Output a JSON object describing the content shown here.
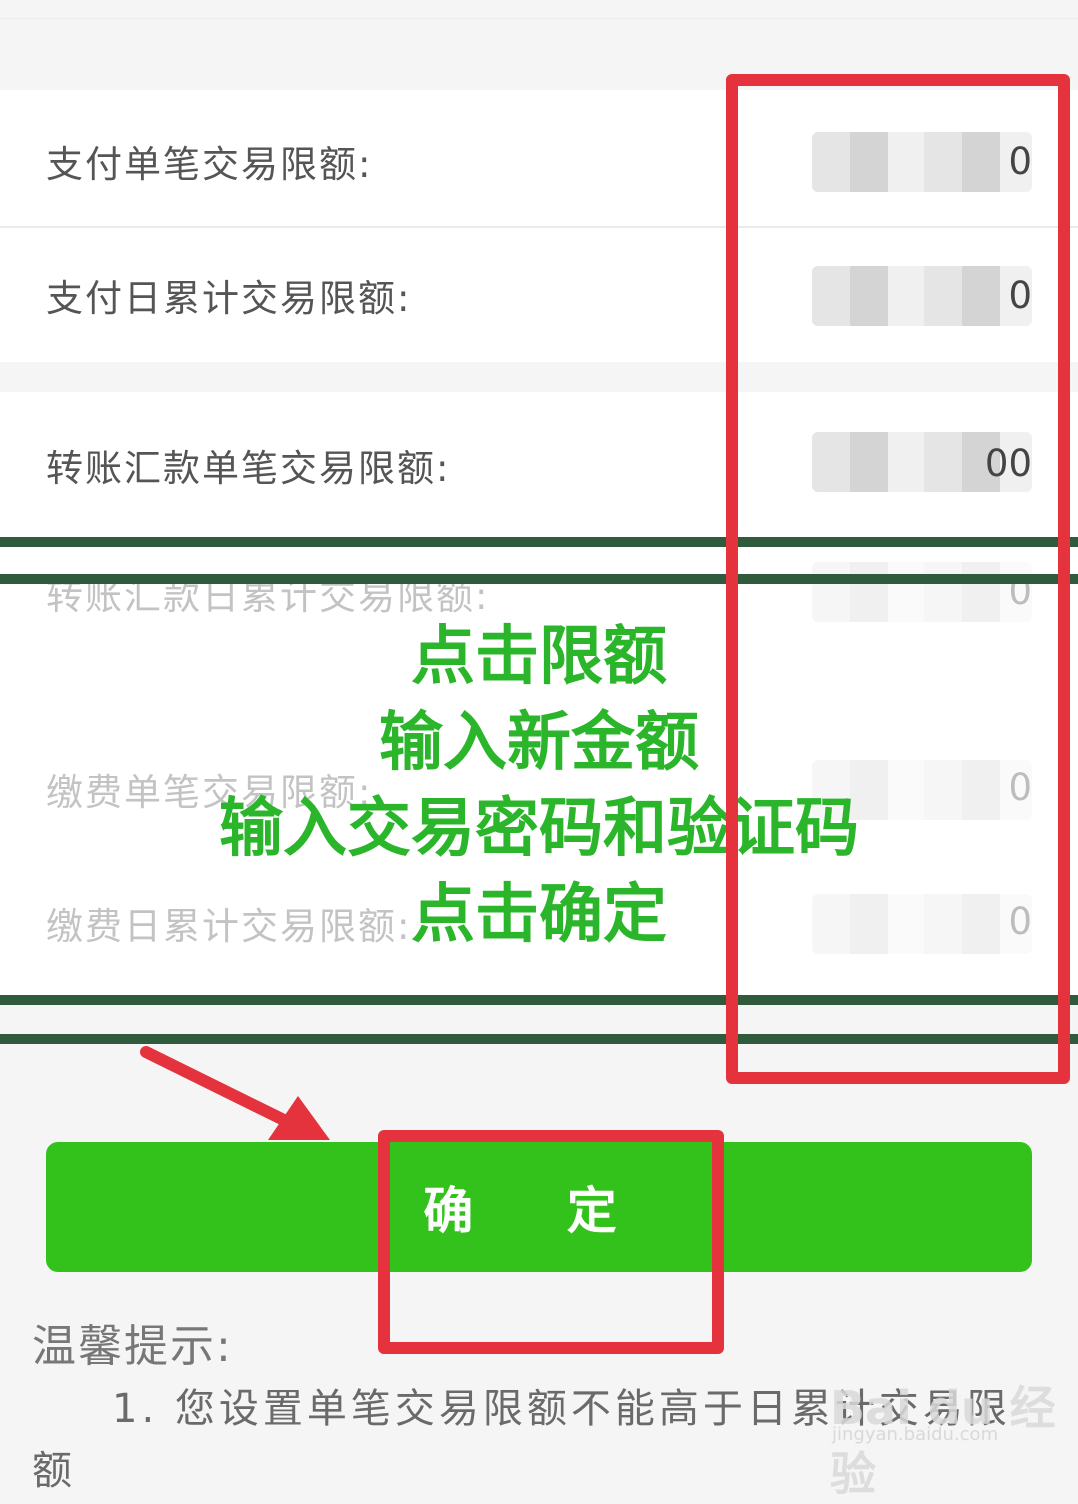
{
  "limits": [
    {
      "label": "支付单笔交易限额:",
      "value": "0"
    },
    {
      "label": "支付日累计交易限额:",
      "value": "0"
    },
    {
      "label": "转账汇款单笔交易限额:",
      "value": "00"
    },
    {
      "label": "转账汇款日累计交易限额:",
      "value": "0"
    },
    {
      "label": "缴费单笔交易限额:",
      "value": "0"
    },
    {
      "label": "缴费日累计交易限额:",
      "value": "0"
    }
  ],
  "overlay": {
    "line1": "点击限额",
    "line2": "输入新金额",
    "line3": "输入交易密码和验证码",
    "line4": "点击确定"
  },
  "confirm_label": "确 定",
  "tips": {
    "title": "温馨提示:",
    "line1": "1. 您设置单笔交易限额不能高于日累计交易限",
    "line2": "额"
  },
  "watermark": {
    "text": "Bai du 经验",
    "sub": "jingyan.baidu.com"
  },
  "colors": {
    "annotation_red": "#e5333d",
    "annotation_green": "#2bb52b",
    "button_green": "#33c11c",
    "band_dark": "#2f5a3c"
  }
}
